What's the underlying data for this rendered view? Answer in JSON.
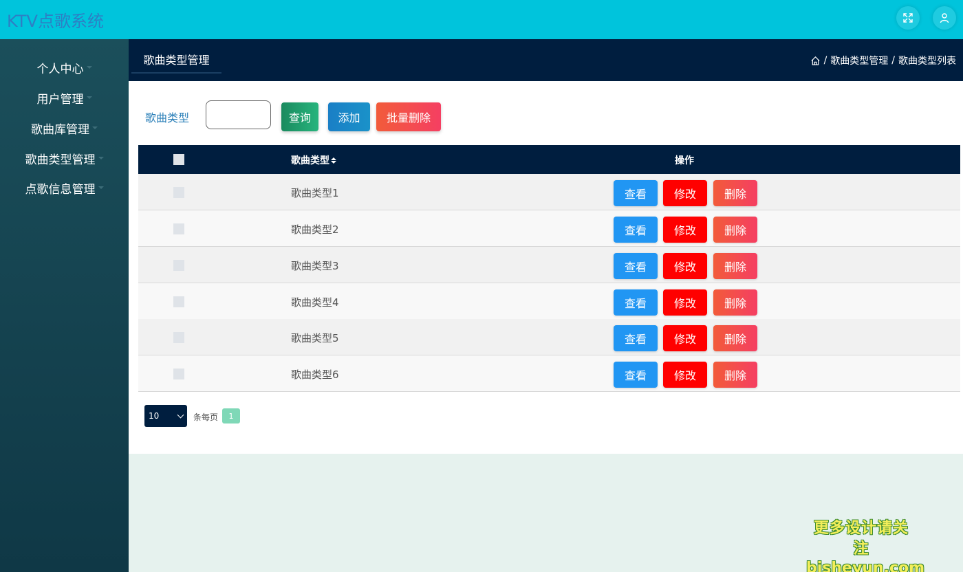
{
  "app": {
    "title": "KTV点歌系统"
  },
  "header": {
    "icons": [
      {
        "name": "fullscreen-icon"
      },
      {
        "name": "user-icon"
      }
    ]
  },
  "sidebar": {
    "items": [
      {
        "label": "个人中心"
      },
      {
        "label": "用户管理"
      },
      {
        "label": "歌曲库管理"
      },
      {
        "label": "歌曲类型管理"
      },
      {
        "label": "点歌信息管理"
      }
    ]
  },
  "page": {
    "title": "歌曲类型管理",
    "breadcrumb": [
      "歌曲类型管理",
      "歌曲类型列表"
    ]
  },
  "search": {
    "label": "歌曲类型",
    "value": "",
    "query_label": "查询",
    "add_label": "添加",
    "batch_delete_label": "批量删除"
  },
  "table": {
    "columns": [
      "歌曲类型",
      "操作"
    ],
    "rows": [
      {
        "name": "歌曲类型1"
      },
      {
        "name": "歌曲类型2"
      },
      {
        "name": "歌曲类型3"
      },
      {
        "name": "歌曲类型4"
      },
      {
        "name": "歌曲类型5"
      },
      {
        "name": "歌曲类型6"
      }
    ],
    "actions": {
      "view": "查看",
      "edit": "修改",
      "delete": "删除"
    }
  },
  "pagination": {
    "page_size": "10",
    "page_size_label": "条每页",
    "current_page": "1"
  },
  "watermark": {
    "line1": "更多设计请关注",
    "line2": "bisheyun.com"
  },
  "colors": {
    "topbar": "#00c4dc",
    "navy": "#001e3f",
    "view_button": "#2196f3",
    "edit_button": "#ff0000",
    "delete_button": "#f7425a",
    "query_button": "#1a9b6f",
    "add_button": "#1a8ac9"
  }
}
